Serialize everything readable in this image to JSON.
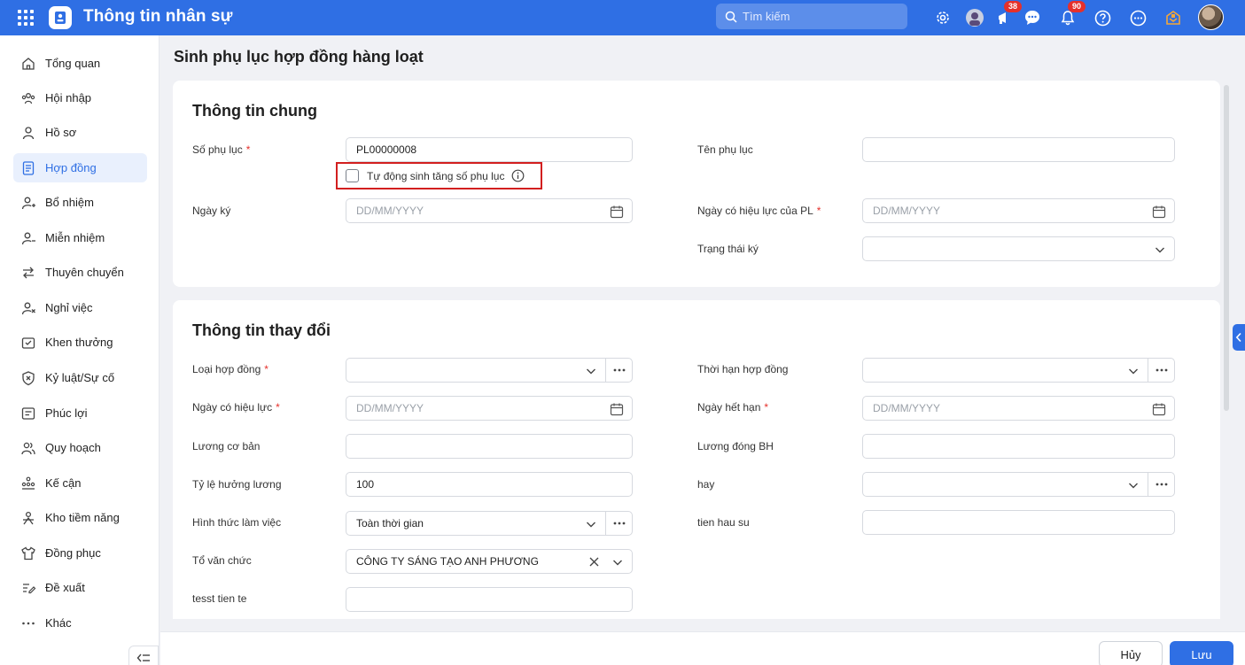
{
  "app": {
    "title": "Thông tin nhân sự"
  },
  "search": {
    "placeholder": "Tìm kiếm"
  },
  "notifications": {
    "announcements_badge": "38",
    "bell_badge": "90"
  },
  "sidebar": {
    "items": [
      {
        "label": "Tổng quan",
        "icon": "home-icon"
      },
      {
        "label": "Hội nhập",
        "icon": "team-icon"
      },
      {
        "label": "Hồ sơ",
        "icon": "user-icon"
      },
      {
        "label": "Hợp đồng",
        "icon": "document-icon",
        "active": true
      },
      {
        "label": "Bổ nhiệm",
        "icon": "user-plus-icon"
      },
      {
        "label": "Miễn nhiệm",
        "icon": "user-minus-icon"
      },
      {
        "label": "Thuyên chuyển",
        "icon": "transfer-icon"
      },
      {
        "label": "Nghỉ việc",
        "icon": "user-leave-icon"
      },
      {
        "label": "Khen thưởng",
        "icon": "reward-icon"
      },
      {
        "label": "Kỷ luật/Sự cố",
        "icon": "shield-icon"
      },
      {
        "label": "Phúc lợi",
        "icon": "benefit-icon"
      },
      {
        "label": "Quy hoạch",
        "icon": "users-icon"
      },
      {
        "label": "Kế cận",
        "icon": "org-chart-icon"
      },
      {
        "label": "Kho tiềm năng",
        "icon": "talent-icon"
      },
      {
        "label": "Đồng phục",
        "icon": "shirt-icon"
      },
      {
        "label": "Đề xuất",
        "icon": "proposal-icon"
      },
      {
        "label": "Khác",
        "icon": "more-icon"
      }
    ]
  },
  "page": {
    "title": "Sinh phụ lục hợp đồng hàng loạt"
  },
  "general": {
    "title": "Thông tin chung",
    "appendix_no": {
      "label": "Số phụ lục",
      "value": "PL00000008"
    },
    "auto_increment": {
      "label": "Tự động sinh tăng số phụ lục",
      "checked": false
    },
    "appendix_name": {
      "label": "Tên phụ lục",
      "value": ""
    },
    "sign_date": {
      "label": "Ngày ký",
      "placeholder": "DD/MM/YYYY"
    },
    "effective_date_pl": {
      "label": "Ngày có hiệu lực của PL",
      "placeholder": "DD/MM/YYYY"
    },
    "sign_status": {
      "label": "Trạng thái ký",
      "value": ""
    }
  },
  "changes": {
    "title": "Thông tin thay đổi",
    "contract_type": {
      "label": "Loại hợp đồng",
      "value": ""
    },
    "contract_term": {
      "label": "Thời hạn hợp đồng",
      "value": ""
    },
    "effective_date": {
      "label": "Ngày có hiệu lực",
      "placeholder": "DD/MM/YYYY"
    },
    "expiry_date": {
      "label": "Ngày hết hạn",
      "placeholder": "DD/MM/YYYY"
    },
    "base_salary": {
      "label": "Lương cơ bản",
      "value": ""
    },
    "insurance_salary": {
      "label": "Lương đóng BH",
      "value": ""
    },
    "salary_rate": {
      "label": "Tỷ lệ hưởng lương",
      "value": "100"
    },
    "hay": {
      "label": "hay",
      "value": ""
    },
    "work_form": {
      "label": "Hình thức làm việc",
      "value": "Toàn thời gian"
    },
    "tien_hau_su": {
      "label": "tien hau su",
      "value": ""
    },
    "org": {
      "label": "Tổ văn chức",
      "value": "CÔNG TY SÁNG TẠO ANH PHƯƠNG"
    },
    "tesst_tien_te": {
      "label": "tesst tien te",
      "value": ""
    }
  },
  "actions": {
    "cancel": "Hủy",
    "save": "Lưu"
  },
  "colors": {
    "primary": "#2f6fe4",
    "required": "#e5302b",
    "highlight_border": "#d21f1f"
  }
}
